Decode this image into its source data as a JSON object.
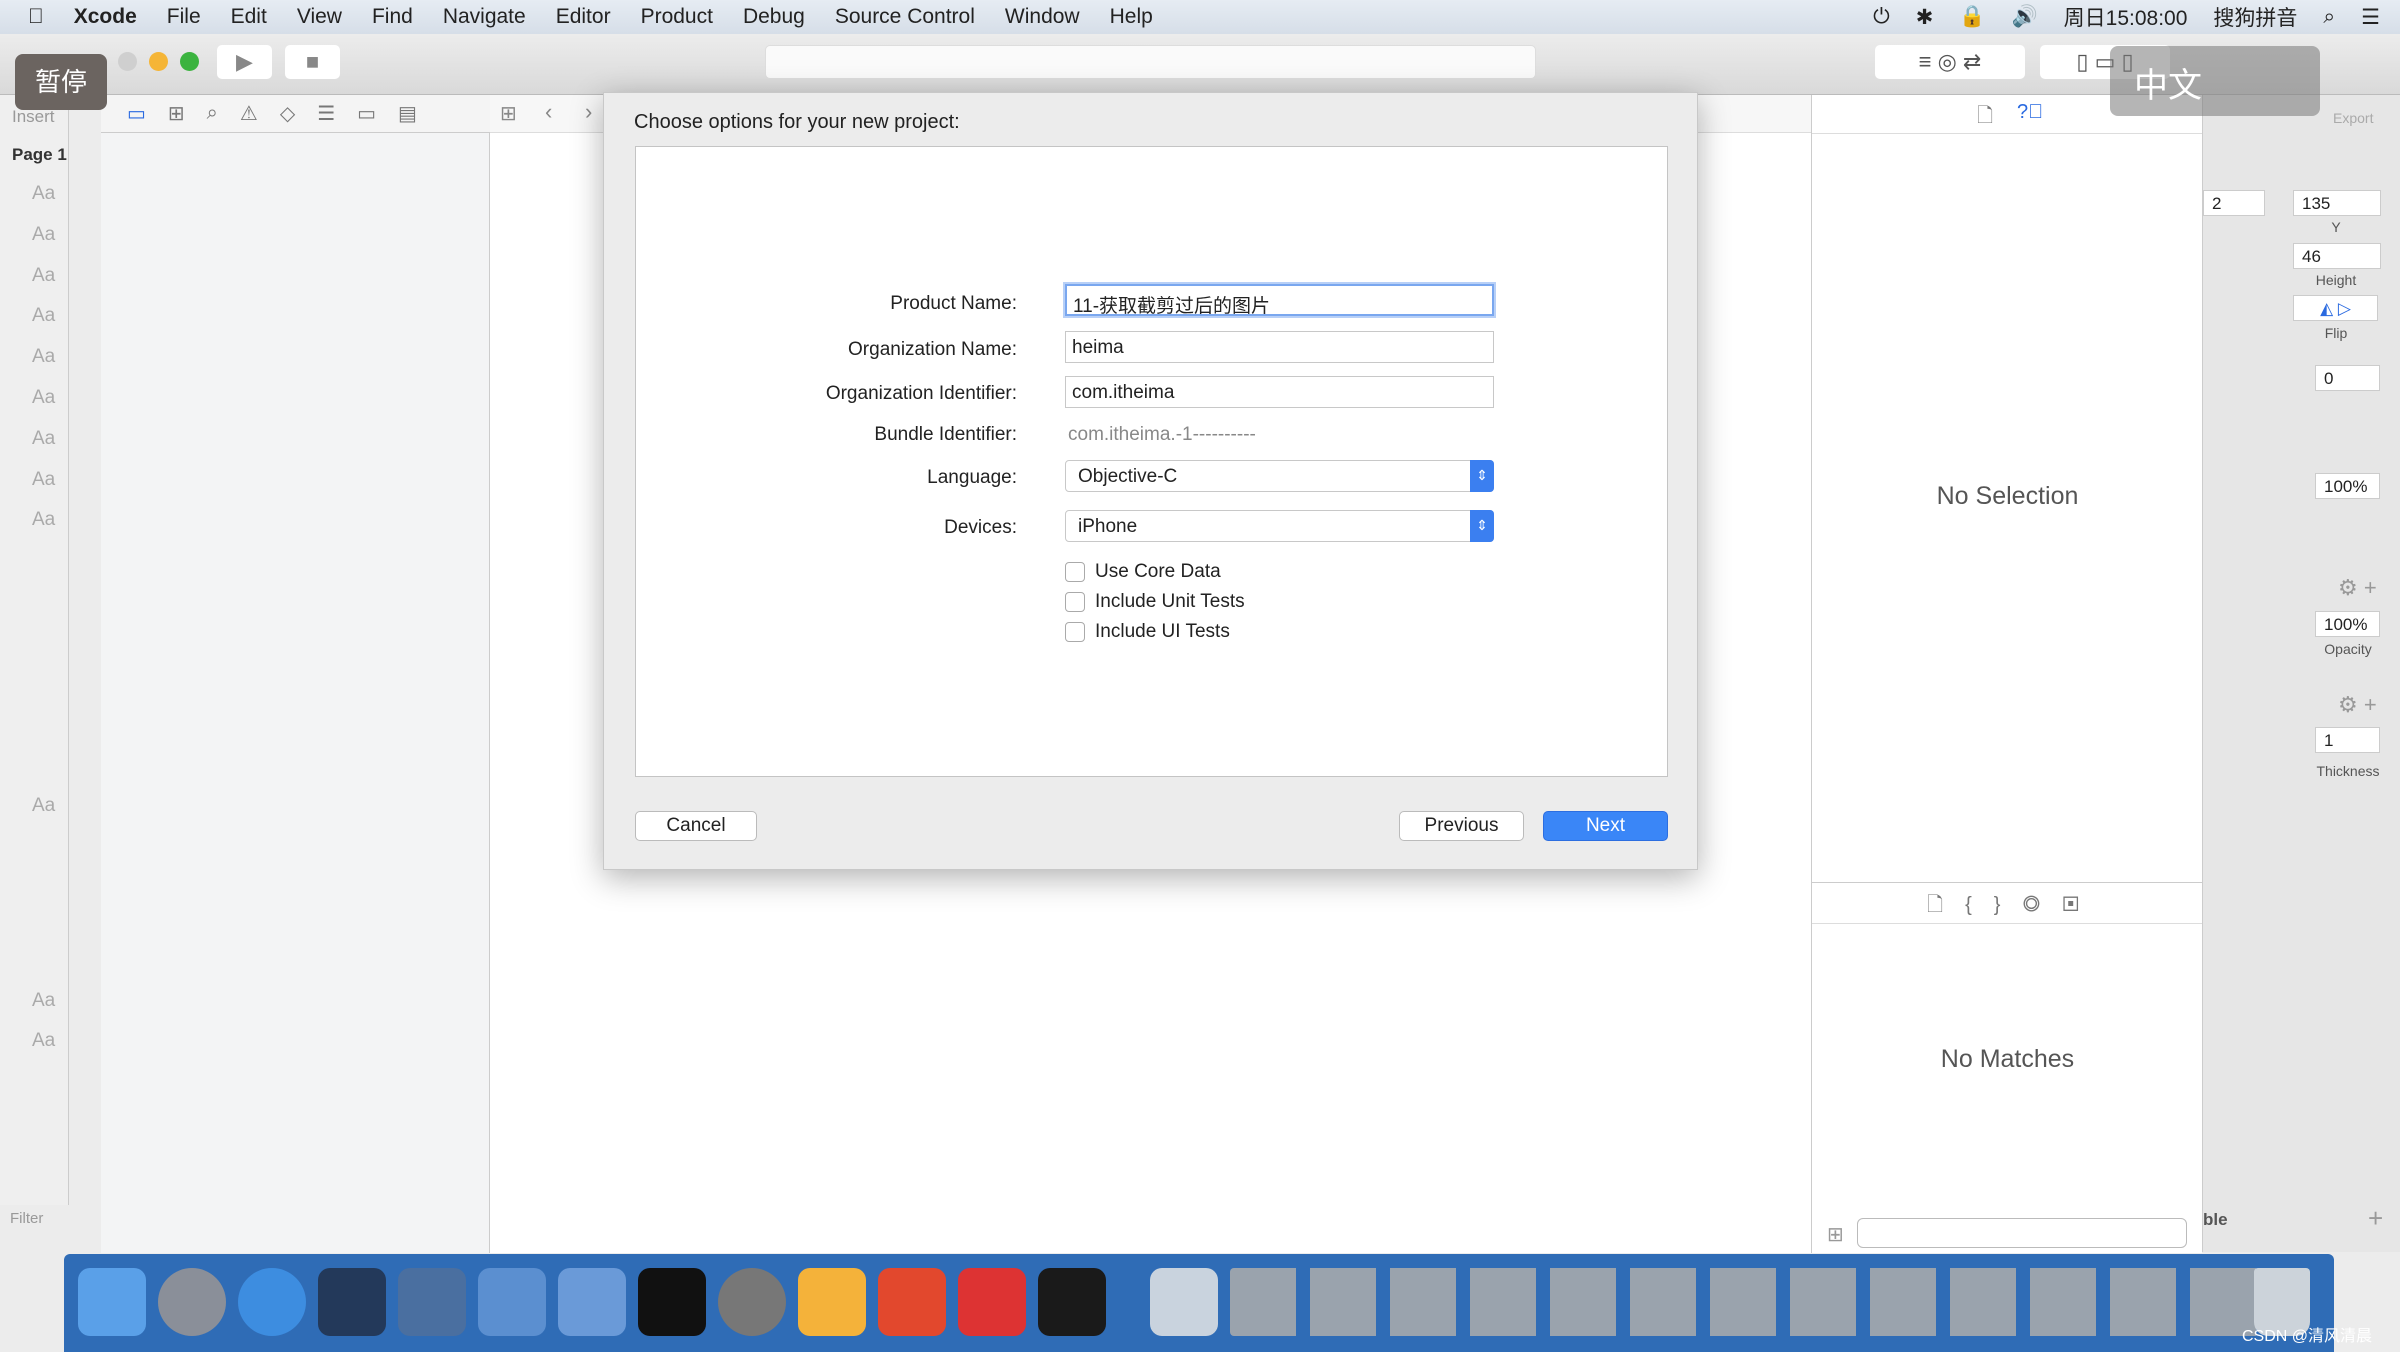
{
  "menubar": {
    "app": "Xcode",
    "items": [
      "File",
      "Edit",
      "View",
      "Find",
      "Navigate",
      "Editor",
      "Product",
      "Debug",
      "Source Control",
      "Window",
      "Help"
    ],
    "clock": "周日15:08:00",
    "input_method": "搜狗拼音"
  },
  "overlay": {
    "pause": "暂停",
    "ime": "中文",
    "watermark": "CSDN @清风清晨"
  },
  "sketch_left": {
    "insert": "Insert",
    "page": "Page 1",
    "aa": "Aa",
    "filter": "Filter"
  },
  "dialog": {
    "title": "Choose options for your new project:",
    "fields": {
      "product_name_label": "Product Name:",
      "product_name": "11-获取截剪过后的图片",
      "org_name_label": "Organization Name:",
      "org_name": "heima",
      "org_id_label": "Organization Identifier:",
      "org_id": "com.itheima",
      "bundle_id_label": "Bundle Identifier:",
      "bundle_id": "com.itheima.-1----------",
      "language_label": "Language:",
      "language": "Objective-C",
      "devices_label": "Devices:",
      "devices": "iPhone"
    },
    "checkboxes": [
      {
        "label": "Use Core Data",
        "checked": false
      },
      {
        "label": "Include Unit Tests",
        "checked": false
      },
      {
        "label": "Include UI Tests",
        "checked": false
      }
    ],
    "cancel": "Cancel",
    "previous": "Previous",
    "next": "Next"
  },
  "inspector": {
    "no_selection": "No Selection",
    "no_matches": "No Matches"
  },
  "sketch_right": {
    "x_val": "2",
    "y_val": "135",
    "y_label": "Y",
    "height_val": "46",
    "height_label": "Height",
    "flip_label": "Flip",
    "rot_val": "0",
    "pct1": "100%",
    "opacity_val": "100%",
    "opacity_label": "Opacity",
    "thickness_val": "1",
    "thickness_label": "Thickness",
    "export": "Export",
    "table_label": "ble"
  },
  "colors": {
    "accent": "#3a86f7",
    "dock": "#2f6cb6"
  }
}
